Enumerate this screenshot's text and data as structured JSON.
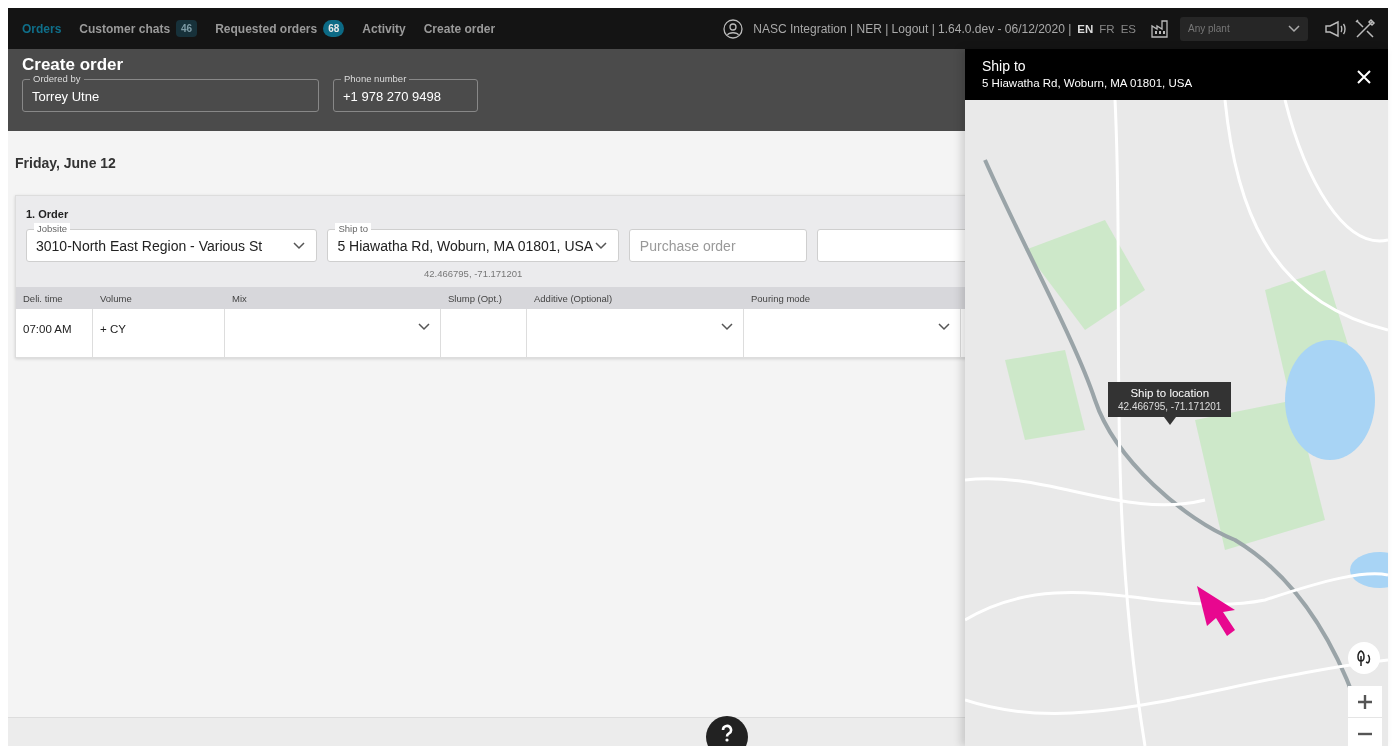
{
  "nav": {
    "tabs": [
      {
        "label": "Orders",
        "selected": true
      },
      {
        "label": "Customer chats",
        "badge": "46",
        "badge_highlighted": false,
        "selected": false
      },
      {
        "label": "Requested orders",
        "badge": "68",
        "badge_highlighted": true,
        "selected": false
      },
      {
        "label": "Activity",
        "selected": false
      },
      {
        "label": "Create order",
        "selected": false
      }
    ],
    "user_info": "NASC Integration | NER | Logout | 1.64.0.dev - 06/12/2020 |",
    "languages": [
      {
        "label": "EN",
        "selected": true
      },
      {
        "label": "FR",
        "selected": false
      },
      {
        "label": "ES",
        "selected": false
      }
    ],
    "plant_select": {
      "placeholder": "Any plant"
    }
  },
  "header": {
    "title": "Create order",
    "fields": [
      {
        "label": "Ordered by",
        "value": "Torrey Utne"
      },
      {
        "label": "Phone number",
        "value": "+1 978 270 9498"
      }
    ]
  },
  "date": "Friday, June 12",
  "order": {
    "title": "1. Order",
    "fields": [
      {
        "kind": "select",
        "label": "Jobsite",
        "value": "3010-North East Region - Various St"
      },
      {
        "kind": "select",
        "label": "Ship to",
        "value": "5 Hiawatha Rd, Woburn, MA 01801, USA",
        "hint": "42.466795, -71.171201"
      },
      {
        "kind": "text",
        "placeholder": "Purchase order"
      },
      {
        "kind": "text"
      }
    ],
    "table": {
      "columns": [
        "Deli. time",
        "Volume",
        "Mix",
        "Slump (Opt.)",
        "Additive (Optional)",
        "Pouring mode"
      ],
      "rows": [
        [
          {
            "kind": "text",
            "value": "07:00 AM"
          },
          {
            "kind": "text",
            "value": "+ CY"
          },
          {
            "kind": "select"
          },
          {
            "kind": "text"
          },
          {
            "kind": "select"
          },
          {
            "kind": "select"
          }
        ]
      ]
    }
  },
  "panel": {
    "title": "Ship to",
    "address": "5 Hiawatha Rd, Woburn, MA 01801, USA",
    "tooltip": {
      "title": "Ship to location",
      "coords": "42.466795, -71.171201"
    }
  }
}
